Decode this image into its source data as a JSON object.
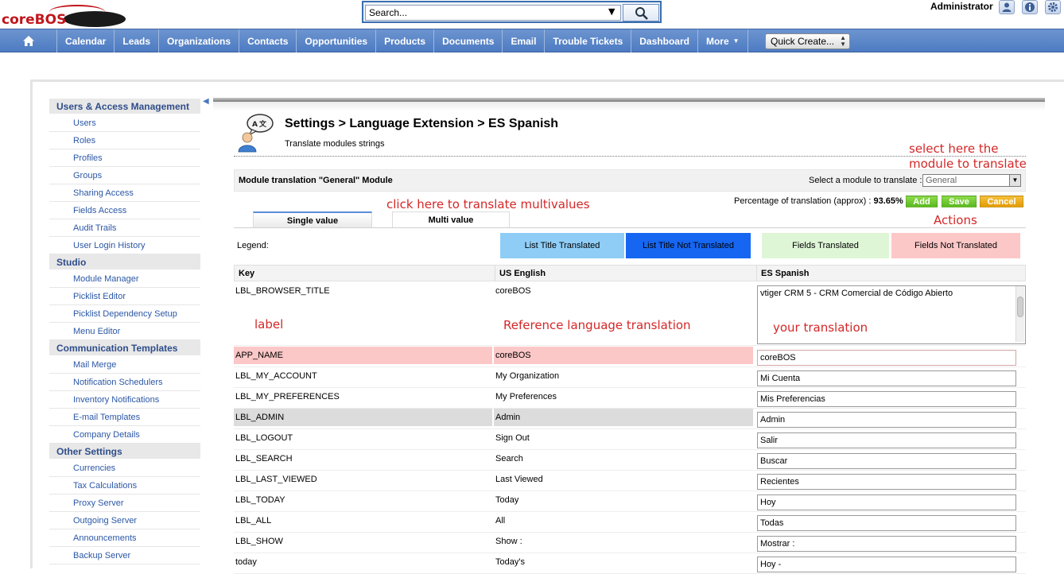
{
  "header": {
    "logo_text": "coreBOS",
    "search_placeholder": "Search...",
    "user_name": "Administrator",
    "icons": [
      "user-icon",
      "info-icon",
      "gear-icon"
    ]
  },
  "nav": {
    "home_icon": "home-icon",
    "items": [
      "Calendar",
      "Leads",
      "Organizations",
      "Contacts",
      "Opportunities",
      "Products",
      "Documents",
      "Email",
      "Trouble Tickets",
      "Dashboard",
      "More"
    ],
    "quick_create": "Quick Create..."
  },
  "sidebar": {
    "sections": [
      {
        "title": "Users & Access Management",
        "items": [
          "Users",
          "Roles",
          "Profiles",
          "Groups",
          "Sharing Access",
          "Fields Access",
          "Audit Trails",
          "User Login History"
        ]
      },
      {
        "title": "Studio",
        "items": [
          "Module Manager",
          "Picklist Editor",
          "Picklist Dependency Setup",
          "Menu Editor"
        ]
      },
      {
        "title": "Communication Templates",
        "items": [
          "Mail Merge",
          "Notification Schedulers",
          "Inventory Notifications",
          "E-mail Templates",
          "Company Details"
        ]
      },
      {
        "title": "Other Settings",
        "items": [
          "Currencies",
          "Tax Calculations",
          "Proxy Server",
          "Outgoing Server",
          "Announcements",
          "Backup Server"
        ]
      }
    ]
  },
  "main": {
    "title": "Settings > Language Extension > ES Spanish",
    "subtitle": "Translate modules strings",
    "module_bar_title": "Module translation \"General\" Module",
    "select_label": "Select a module to translate :",
    "select_value": "General",
    "percentage_label": "Percentage of translation (approx) :",
    "percentage_value": "93.65%",
    "buttons": {
      "add": "Add",
      "save": "Save",
      "cancel": "Cancel"
    },
    "tabs": {
      "single": "Single value",
      "multi": "Multi value"
    },
    "legend_label": "Legend:",
    "legend": {
      "list_translated": "List Title Translated",
      "list_not_translated": "List Title Not Translated",
      "fields_translated": "Fields Translated",
      "fields_not_translated": "Fields Not Translated"
    },
    "columns": {
      "key": "Key",
      "en": "US English",
      "es": "ES Spanish"
    },
    "annotations": {
      "select_here_1": "select here the",
      "select_here_2": "module to translate",
      "multivalues": "click here to translate multivalues",
      "actions": "Actions",
      "label": "label",
      "reference": "Reference language translation",
      "your_translation": "your translation"
    },
    "first_row": {
      "key": "LBL_BROWSER_TITLE",
      "en": "coreBOS",
      "es": "vtiger CRM 5 - CRM Comercial de Código Abierto"
    },
    "rows": [
      {
        "key": "APP_NAME",
        "en": "coreBOS",
        "es": "coreBOS"
      },
      {
        "key": "LBL_MY_ACCOUNT",
        "en": "My Organization",
        "es": "Mi Cuenta"
      },
      {
        "key": "LBL_MY_PREFERENCES",
        "en": "My Preferences",
        "es": "Mis Preferencias"
      },
      {
        "key": "LBL_ADMIN",
        "en": "Admin",
        "es": "Admin"
      },
      {
        "key": "LBL_LOGOUT",
        "en": "Sign Out",
        "es": "Salir"
      },
      {
        "key": "LBL_SEARCH",
        "en": "Search",
        "es": "Buscar"
      },
      {
        "key": "LBL_LAST_VIEWED",
        "en": "Last Viewed",
        "es": "Recientes"
      },
      {
        "key": "LBL_TODAY",
        "en": "Today",
        "es": "Hoy"
      },
      {
        "key": "LBL_ALL",
        "en": "All",
        "es": "Todas"
      },
      {
        "key": "LBL_SHOW",
        "en": "Show :",
        "es": "Mostrar :"
      },
      {
        "key": "today",
        "en": "Today's",
        "es": "Hoy -"
      }
    ],
    "colors": {
      "annotation": "#d42727",
      "untranslated": "#fcc7c7",
      "selected": "#dcdcdc"
    }
  }
}
